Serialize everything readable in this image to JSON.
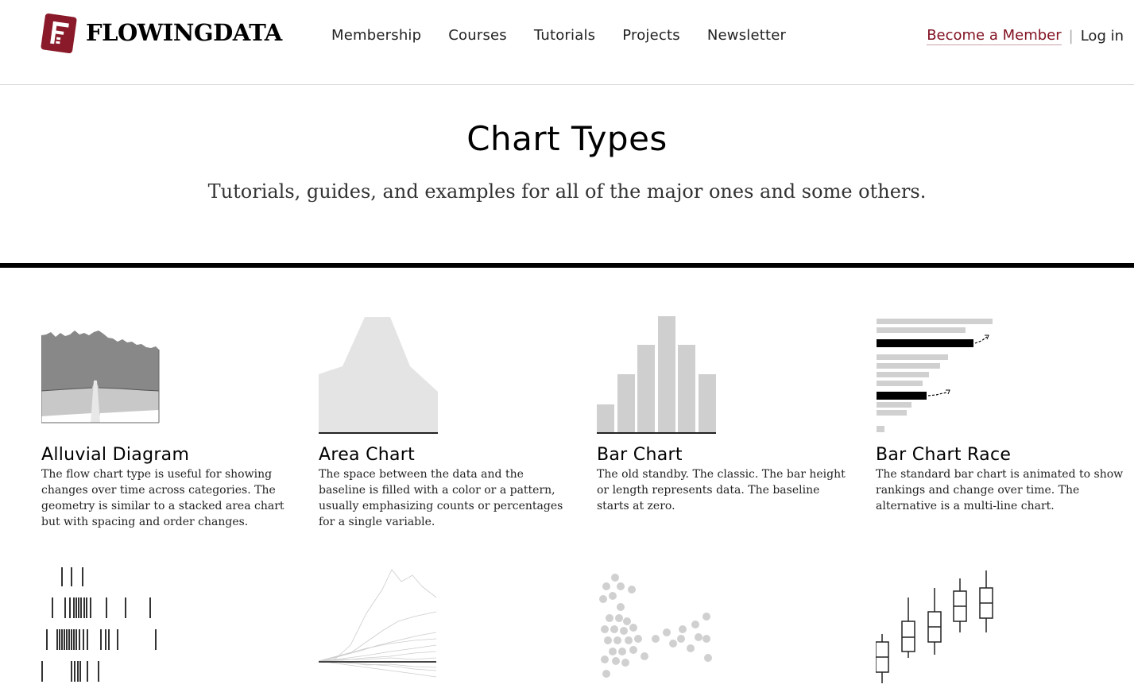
{
  "brand": {
    "name": "FLOWINGDATA",
    "color": "#8a1a2a"
  },
  "nav": {
    "items": [
      "Membership",
      "Courses",
      "Tutorials",
      "Projects",
      "Newsletter"
    ],
    "become_member": "Become a Member",
    "separator": "|",
    "login": "Log in",
    "accent_color": "#821122"
  },
  "hero": {
    "title": "Chart Types",
    "subtitle": "Tutorials, guides, and examples for all of the major ones and some others."
  },
  "cards": [
    {
      "title": "Alluvial Diagram",
      "description": "The flow chart type is useful for showing changes over time across categories. The geometry is similar to a stacked area chart but with spacing and order changes.",
      "icon": "alluvial-diagram-icon"
    },
    {
      "title": "Area Chart",
      "description": "The space between the data and the baseline is filled with a color or a pattern, usually emphasizing counts or percentages for a single variable.",
      "icon": "area-chart-icon"
    },
    {
      "title": "Bar Chart",
      "description": "The old standby. The classic. The bar height or length represents data. The baseline starts at zero.",
      "icon": "bar-chart-icon"
    },
    {
      "title": "Bar Chart Race",
      "description": "The standard bar chart is animated to show rankings and change over time. The alternative is a multi-line chart.",
      "icon": "bar-chart-race-icon"
    },
    {
      "title": "",
      "description": "",
      "icon": "barcode-chart-icon"
    },
    {
      "title": "",
      "description": "",
      "icon": "multi-line-chart-icon"
    },
    {
      "title": "",
      "description": "",
      "icon": "beeswarm-chart-icon"
    },
    {
      "title": "",
      "description": "",
      "icon": "candlestick-chart-icon"
    }
  ]
}
